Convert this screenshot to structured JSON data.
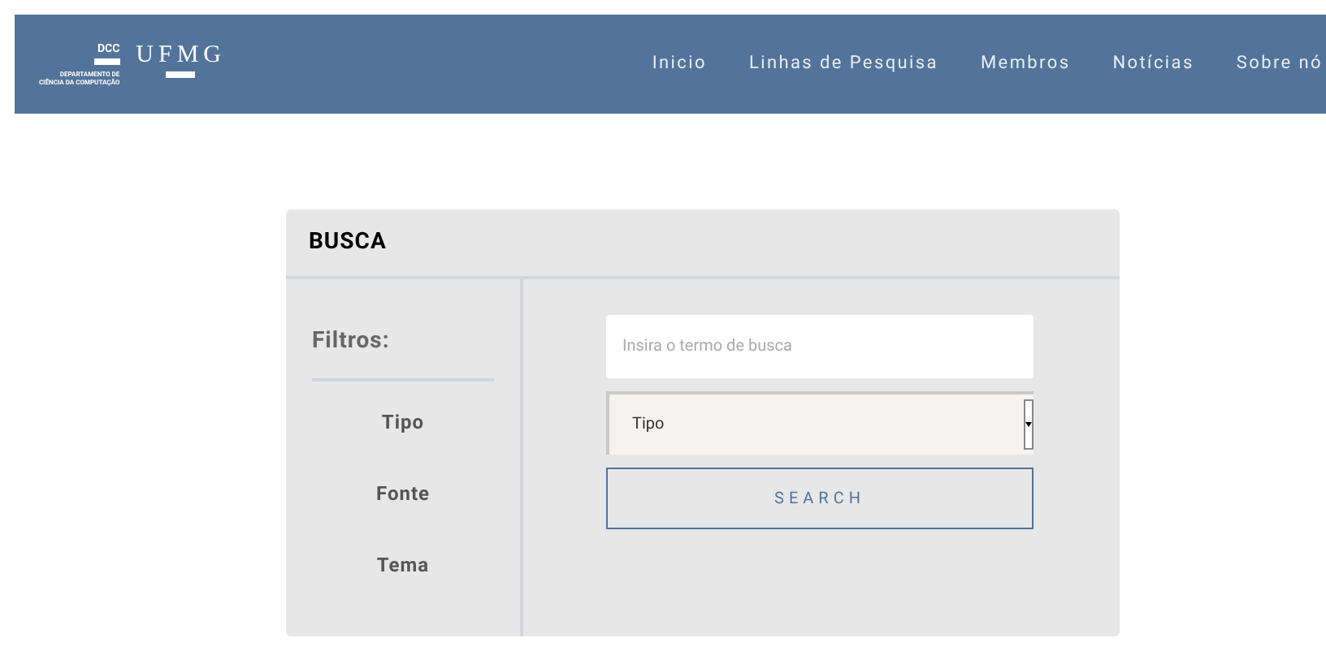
{
  "header": {
    "dept_logo": {
      "acronym": "DCC",
      "line_1": "DEPARTAMENTO DE",
      "line_2": "CIÊNCIA DA COMPUTAÇÃO"
    },
    "university_logo": "UFMG",
    "nav": [
      {
        "label": "Inicio"
      },
      {
        "label": "Linhas de Pesquisa"
      },
      {
        "label": "Membros"
      },
      {
        "label": "Notícias"
      },
      {
        "label": "Sobre nó"
      }
    ]
  },
  "search_panel": {
    "title": "BUSCA",
    "filters_heading": "Filtros:",
    "filters": [
      {
        "label": "Tipo"
      },
      {
        "label": "Fonte"
      },
      {
        "label": "Tema"
      }
    ],
    "search_field": {
      "placeholder": "Insira o termo de busca"
    },
    "type_select": {
      "value": "Tipo"
    },
    "search_button": "SEARCH"
  }
}
